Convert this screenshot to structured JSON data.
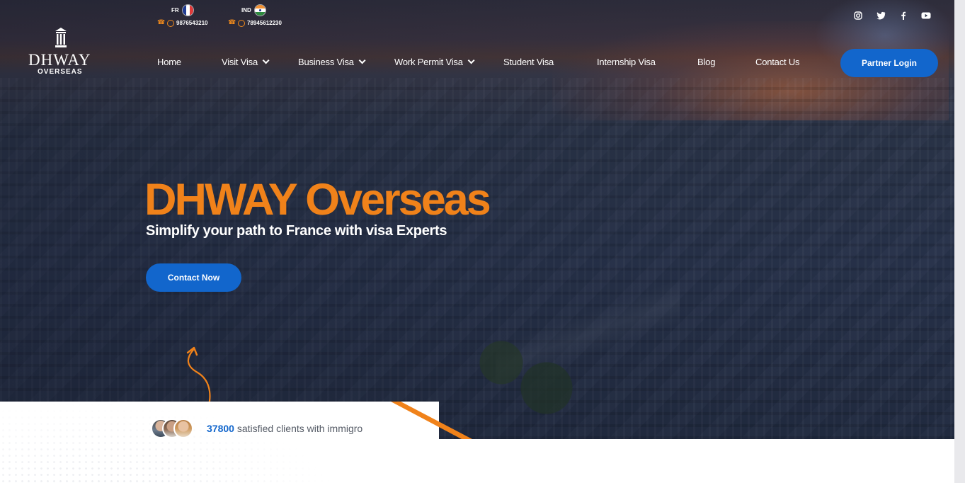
{
  "contacts": [
    {
      "code": "FR",
      "phone": "9876543210",
      "flag_icon": "france-flag-icon"
    },
    {
      "code": "IND",
      "phone": "78945612230",
      "flag_icon": "india-flag-icon"
    }
  ],
  "logo": {
    "wordmark": "DHWAY",
    "sub": "OVERSEAS"
  },
  "nav": {
    "items": [
      {
        "label": "Home",
        "dropdown": false
      },
      {
        "label": "Visit Visa",
        "dropdown": true
      },
      {
        "label": "Business Visa",
        "dropdown": true
      },
      {
        "label": "Work Permit Visa",
        "dropdown": true
      },
      {
        "label": "Student Visa",
        "dropdown": false
      },
      {
        "label": "Internship Visa",
        "dropdown": false
      },
      {
        "label": "Blog",
        "dropdown": false
      },
      {
        "label": "Contact Us",
        "dropdown": false
      }
    ],
    "partner_login": "Partner Login"
  },
  "social": [
    "instagram-icon",
    "twitter-icon",
    "facebook-icon",
    "youtube-icon"
  ],
  "hero": {
    "title": "DHWAY Overseas",
    "subtitle": "Simplify your path to France with visa Experts",
    "cta": "Contact Now"
  },
  "stats": {
    "count": "37800",
    "text": " satisfied clients with immigro"
  },
  "colors": {
    "accent": "#f0821a",
    "primary": "#1266cc",
    "text_muted": "#555b66"
  }
}
